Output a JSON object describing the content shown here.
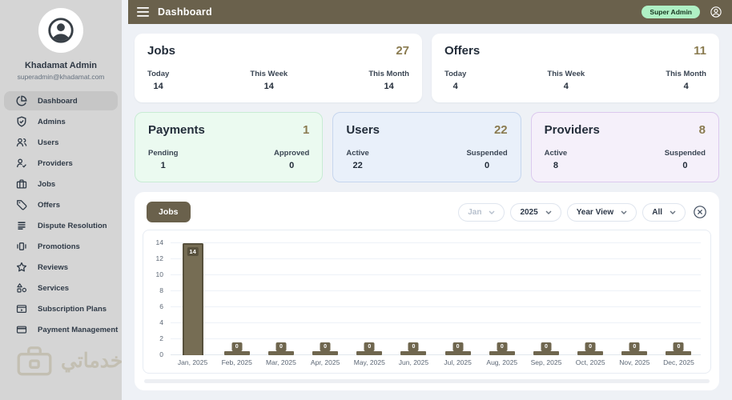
{
  "header": {
    "title": "Dashboard",
    "badge": "Super Admin",
    "bg_color": "#6a614c",
    "badge_bg": "#aff0c4"
  },
  "sidebar": {
    "user_name": "Khadamat Admin",
    "user_email": "superadmin@khadamat.com",
    "watermark": "خدماتي",
    "items": [
      {
        "label": "Dashboard",
        "icon": "pie-chart-icon",
        "active": true
      },
      {
        "label": "Admins",
        "icon": "shield-check-icon",
        "active": false
      },
      {
        "label": "Users",
        "icon": "users-icon",
        "active": false
      },
      {
        "label": "Providers",
        "icon": "user-check-icon",
        "active": false
      },
      {
        "label": "Jobs",
        "icon": "briefcase-icon",
        "active": false
      },
      {
        "label": "Offers",
        "icon": "tag-icon",
        "active": false
      },
      {
        "label": "Dispute Resolution",
        "icon": "stacked-lines-icon",
        "active": false
      },
      {
        "label": "Promotions",
        "icon": "carousel-icon",
        "active": false
      },
      {
        "label": "Reviews",
        "icon": "star-icon",
        "active": false
      },
      {
        "label": "Services",
        "icon": "shapes-icon",
        "active": false
      },
      {
        "label": "Subscription Plans",
        "icon": "subscription-card-icon",
        "active": false
      },
      {
        "label": "Payment Management",
        "icon": "credit-card-icon",
        "active": false
      }
    ]
  },
  "stat_cards_row1": [
    {
      "title": "Jobs",
      "total": "27",
      "metrics": [
        {
          "label": "Today",
          "value": "14"
        },
        {
          "label": "This Week",
          "value": "14"
        },
        {
          "label": "This Month",
          "value": "14"
        }
      ]
    },
    {
      "title": "Offers",
      "total": "11",
      "metrics": [
        {
          "label": "Today",
          "value": "4"
        },
        {
          "label": "This Week",
          "value": "4"
        },
        {
          "label": "This Month",
          "value": "4"
        }
      ]
    }
  ],
  "stat_cards_row2": [
    {
      "title": "Payments",
      "total": "1",
      "bg": "#ebfaf0",
      "border": "#c8ecd4",
      "metrics": [
        {
          "label": "Pending",
          "value": "1"
        },
        {
          "label": "Approved",
          "value": "0"
        }
      ]
    },
    {
      "title": "Users",
      "total": "22",
      "bg": "#e9f0fa",
      "border": "#c6d6ee",
      "metrics": [
        {
          "label": "Active",
          "value": "22"
        },
        {
          "label": "Suspended",
          "value": "0"
        }
      ]
    },
    {
      "title": "Providers",
      "total": "8",
      "bg": "#f5f0fa",
      "border": "#dcc9ee",
      "metrics": [
        {
          "label": "Active",
          "value": "8"
        },
        {
          "label": "Suspended",
          "value": "0"
        }
      ]
    }
  ],
  "chart_panel": {
    "tab_label": "Jobs",
    "filters": [
      {
        "value": "Jan",
        "disabled": true
      },
      {
        "value": "2025",
        "disabled": false
      },
      {
        "value": "Year View",
        "disabled": false
      },
      {
        "value": "All",
        "disabled": false
      }
    ],
    "close_icon": "circle-x-icon"
  },
  "chart_data": {
    "type": "bar",
    "title": "Jobs per month",
    "categories": [
      "Jan, 2025",
      "Feb, 2025",
      "Mar, 2025",
      "Apr, 2025",
      "May, 2025",
      "Jun, 2025",
      "Jul, 2025",
      "Aug, 2025",
      "Sep, 2025",
      "Oct, 2025",
      "Nov, 2025",
      "Dec, 2025"
    ],
    "values": [
      14,
      0,
      0,
      0,
      0,
      0,
      0,
      0,
      0,
      0,
      0,
      0
    ],
    "xlabel": "",
    "ylabel": "",
    "ylim": [
      0,
      14
    ],
    "yticks": [
      0,
      2,
      4,
      6,
      8,
      10,
      12,
      14
    ],
    "grid": true,
    "legend": false,
    "bar_color": "#766d54",
    "bar_border_color": "#57503c",
    "value_labels_shown": true
  },
  "accent_color": "#8a7b50"
}
